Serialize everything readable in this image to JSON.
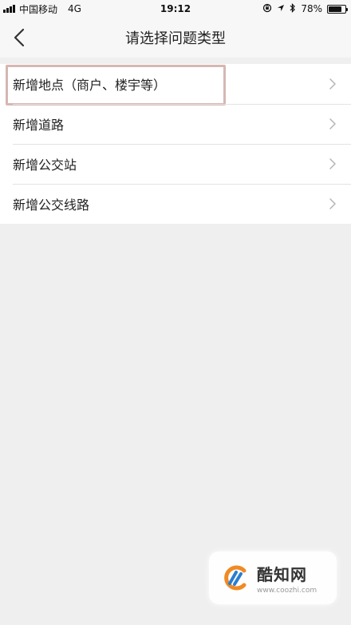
{
  "status_bar": {
    "carrier": "中国移动",
    "network": "4G",
    "time": "19:12",
    "battery_percent": "78%",
    "battery_level": 0.78
  },
  "nav": {
    "title": "请选择问题类型"
  },
  "items": [
    {
      "label": "新增地点（商户、楼宇等）"
    },
    {
      "label": "新增道路"
    },
    {
      "label": "新增公交站"
    },
    {
      "label": "新增公交线路"
    }
  ],
  "watermark": {
    "title": "酷知网",
    "url": "www.coozhi.com"
  },
  "colors": {
    "background": "#efefef",
    "list_background": "#ffffff",
    "highlight_border": "#d6b7b2",
    "chevron": "#b5b5b5",
    "logo_orange": "#f08a24",
    "logo_blue": "#2a7dd1"
  }
}
